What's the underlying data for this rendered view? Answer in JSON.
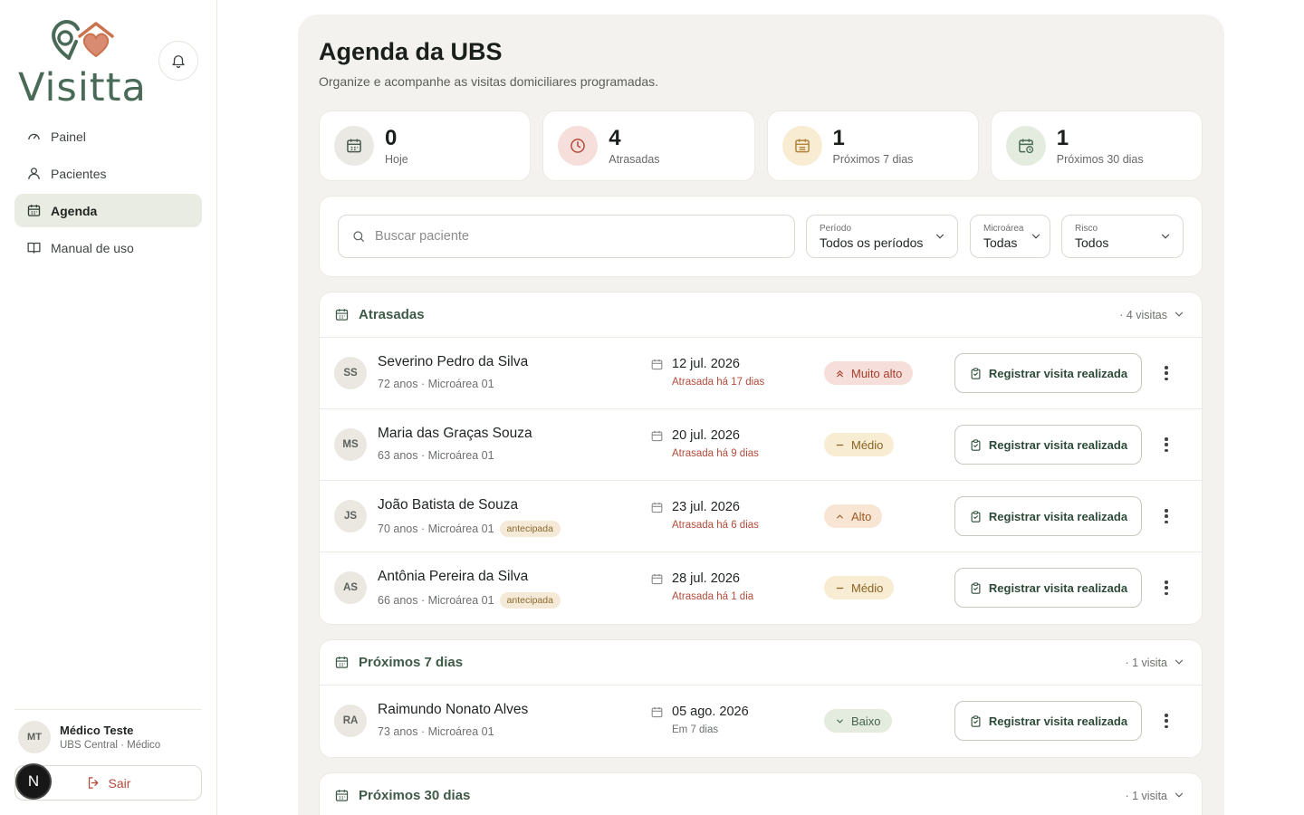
{
  "app": {
    "logo_text": "Visitta"
  },
  "sidebar": {
    "items": [
      {
        "label": "Painel",
        "icon": "gauge-icon"
      },
      {
        "label": "Pacientes",
        "icon": "user-icon"
      },
      {
        "label": "Agenda",
        "icon": "calendar-icon",
        "active": true
      },
      {
        "label": "Manual de uso",
        "icon": "book-icon"
      }
    ],
    "user": {
      "initials": "MT",
      "name": "Médico Teste",
      "role": "UBS Central · Médico"
    },
    "logout_label": "Sair",
    "dev_badge": "N"
  },
  "page": {
    "title": "Agenda da UBS",
    "subtitle": "Organize e acompanhe as visitas domiciliares programadas."
  },
  "stats": [
    {
      "value": "0",
      "label": "Hoje",
      "icon": "calendar-icon"
    },
    {
      "value": "4",
      "label": "Atrasadas",
      "icon": "clock-icon"
    },
    {
      "value": "1",
      "label": "Próximos 7 dias",
      "icon": "calendar-week-icon"
    },
    {
      "value": "1",
      "label": "Próximos 30 dias",
      "icon": "calendar-clock-icon"
    }
  ],
  "filters": {
    "search_placeholder": "Buscar paciente",
    "periodo": {
      "label": "Período",
      "value": "Todos os períodos"
    },
    "microarea": {
      "label": "Microárea",
      "value": "Todas"
    },
    "risco": {
      "label": "Risco",
      "value": "Todos"
    }
  },
  "action_label": "Registrar visita realizada",
  "groups": {
    "atrasadas": {
      "title": "Atrasadas",
      "count": "· 4 visitas",
      "rows": [
        {
          "initials": "SS",
          "name": "Severino Pedro da Silva",
          "meta": "72 anos · Microárea 01",
          "tag": "",
          "date": "12 jul. 2026",
          "status": "Atrasada há 17 dias",
          "risk": "Muito alto"
        },
        {
          "initials": "MS",
          "name": "Maria das Graças Souza",
          "meta": "63 anos · Microárea 01",
          "tag": "",
          "date": "20 jul. 2026",
          "status": "Atrasada há 9 dias",
          "risk": "Médio"
        },
        {
          "initials": "JS",
          "name": "João Batista de Souza",
          "meta": "70 anos · Microárea 01",
          "tag": "antecipada",
          "date": "23 jul. 2026",
          "status": "Atrasada há 6 dias",
          "risk": "Alto"
        },
        {
          "initials": "AS",
          "name": "Antônia Pereira da Silva",
          "meta": "66 anos · Microárea 01",
          "tag": "antecipada",
          "date": "28 jul. 2026",
          "status": "Atrasada há 1 dia",
          "risk": "Médio"
        }
      ]
    },
    "proximos7": {
      "title": "Próximos 7 dias",
      "count": "· 1 visita",
      "rows": [
        {
          "initials": "RA",
          "name": "Raimundo Nonato Alves",
          "meta": "73 anos · Microárea 01",
          "tag": "",
          "date": "05 ago. 2026",
          "status": "Em 7 dias",
          "risk": "Baixo"
        }
      ]
    },
    "proximos30": {
      "title": "Próximos 30 dias",
      "count": "· 1 visita"
    }
  },
  "colors": {
    "brand_green": "#4a6a58",
    "brand_heart": "#c9734f",
    "danger": "#b24b3a",
    "surface": "#f4f2ee"
  }
}
